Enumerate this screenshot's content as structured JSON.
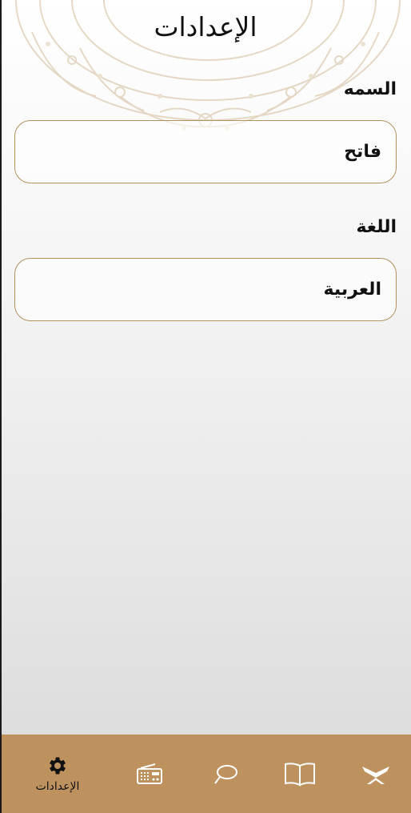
{
  "header": {
    "title": "الإعدادات"
  },
  "settings": {
    "name_label": "السمه",
    "name_value": "فاتح",
    "language_label": "اللغة",
    "language_value": "العربية"
  },
  "bottom_nav": {
    "active_color": "#111111",
    "inactive_color": "#ffffff",
    "background": "#bd925f",
    "items": [
      {
        "icon": "gear-icon",
        "label": "الإعدادات",
        "active": true
      },
      {
        "icon": "radio-icon",
        "active": false
      },
      {
        "icon": "tasbeeh-icon",
        "active": false
      },
      {
        "icon": "book-icon",
        "active": false
      },
      {
        "icon": "quran-icon",
        "active": false
      }
    ]
  }
}
